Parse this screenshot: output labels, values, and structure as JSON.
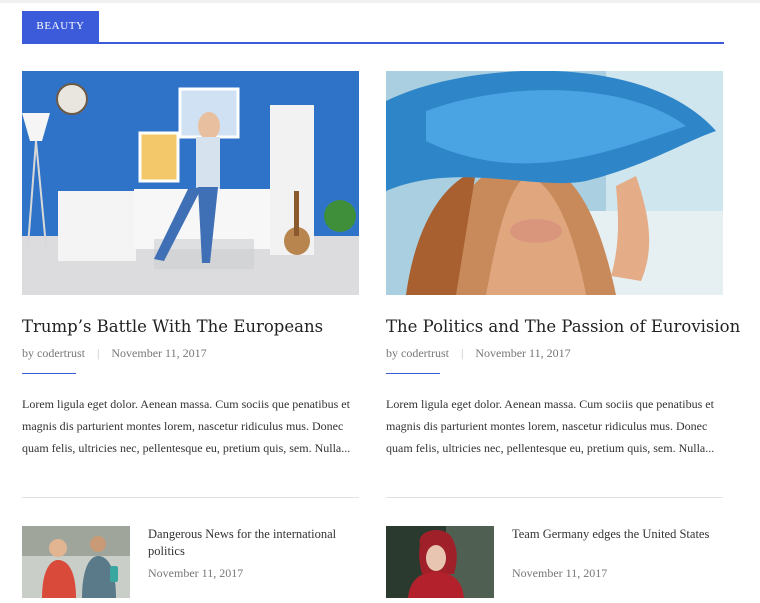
{
  "section": {
    "label": "BEAUTY"
  },
  "featured": [
    {
      "title": "Trump’s Battle With The Europeans",
      "author": "by codertrust",
      "date": "November 11, 2017",
      "excerpt": "Lorem ligula eget dolor. Aenean massa. Cum sociis que penatibus et magnis dis parturient montes lorem, nascetur ridiculus mus. Donec quam felis, ultricies nec, pellentesque eu, pretium quis, sem. Nulla..."
    },
    {
      "title": "The Politics and The Passion of Eurovision",
      "author": "by codertrust",
      "date": "November 11, 2017",
      "excerpt": "Lorem ligula eget dolor. Aenean massa. Cum sociis que penatibus et magnis dis parturient montes lorem, nascetur ridiculus mus. Donec quam felis, ultricies nec, pellentesque eu, pretium quis, sem. Nulla..."
    }
  ],
  "related": [
    {
      "title": "Dangerous News for the international politics",
      "date": "November 11, 2017"
    },
    {
      "title": "Team Germany edges the United States",
      "date": "November 11, 2017"
    }
  ],
  "colors": {
    "accent": "#3b5bdb"
  }
}
